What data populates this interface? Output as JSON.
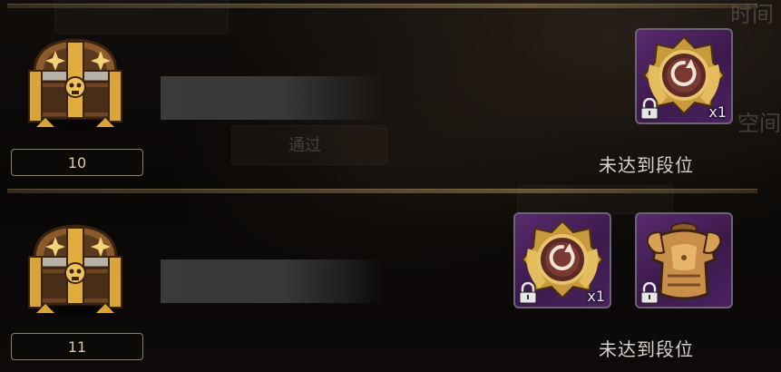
{
  "background": {
    "ghost_texts": [
      "时间",
      "空间",
      "通过"
    ]
  },
  "rewards": [
    {
      "level": "10",
      "status": "未达到段位",
      "items": [
        {
          "icon": "gold-badge-icon",
          "quantity": "x1",
          "locked": true
        }
      ]
    },
    {
      "level": "11",
      "status": "未达到段位",
      "items": [
        {
          "icon": "gold-badge-icon",
          "quantity": "x1",
          "locked": true
        },
        {
          "icon": "bronze-armor-icon",
          "quantity": "",
          "locked": true
        }
      ]
    }
  ],
  "colors": {
    "level_text": "#e3c99b",
    "status_text": "#d8d2cc",
    "slot_purple": "#4a2260"
  }
}
